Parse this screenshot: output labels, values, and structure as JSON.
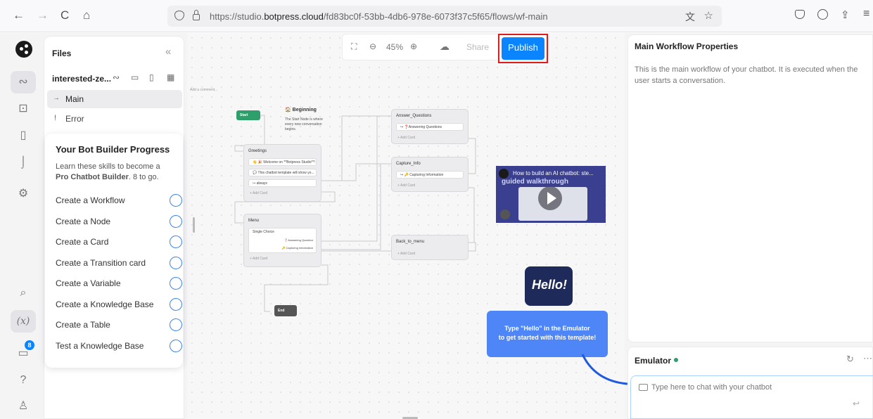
{
  "browser": {
    "back": "←",
    "forward": "→",
    "reload": "C",
    "home": "⌂",
    "url_prefix": "https://studio.",
    "url_domain": "botpress.cloud",
    "url_rest": "/fd83bc0f-53bb-4db6-978e-6073f37c5f65/flows/wf-main"
  },
  "files": {
    "title": "Files",
    "collapse": "«",
    "bot_name": "interested-ze...",
    "items": [
      {
        "label": "Main",
        "icon": "→"
      },
      {
        "label": "Error",
        "icon": "!"
      }
    ]
  },
  "progress": {
    "title": "Your Bot Builder Progress",
    "desc_1": "Learn these skills to become a",
    "desc_bold": "Pro Chatbot Builder",
    "desc_2": ". 8 to go.",
    "items": [
      "Create a Workflow",
      "Create a Node",
      "Create a Card",
      "Create a Transition card",
      "Create a Variable",
      "Create a Knowledge Base",
      "Create a Table",
      "Test a Knowledge Base"
    ]
  },
  "rail": {
    "badge": "8",
    "var": "(x)"
  },
  "toolbar": {
    "zoom": "45%",
    "share": "Share",
    "publish": "Publish"
  },
  "canvas": {
    "add_comment": "Add a comment...",
    "start": "Start",
    "beginning_title": "🏠 Beginning",
    "beginning_desc_1": "The Start Node is where",
    "beginning_desc_2": "every new conversation",
    "beginning_desc_3": "begins.",
    "greetings": {
      "title": "Greetings",
      "cards": [
        "👋 🎉 Welcome on **Botpress Studio**!",
        "💬 This chatbot template will show yo...",
        "↪ always"
      ],
      "add": "+ Add Card"
    },
    "menu": {
      "title": "Menu",
      "card": "Single Choice",
      "opt1": "❓Answering Question",
      "opt2": "🔑 Capturing Information",
      "add": "+ Add Card"
    },
    "answer": {
      "title": "Answer_Questions",
      "card": "↪ ❓Answering Questions",
      "add": "+ Add Card"
    },
    "capture": {
      "title": "Capture_Info",
      "card": "↪ 🔑 Capturing Information",
      "add": "+ Add Card"
    },
    "back": {
      "title": "Back_to_menu",
      "add": "+ Add Card"
    },
    "end": "End",
    "video_title": "How to build an AI chatbot: ste...",
    "video_sub": "guided walkthrough",
    "hello": "Hello!",
    "tip_1": "Type \"Hello\" in the Emulator",
    "tip_2": "to get started with this template!"
  },
  "right": {
    "title": "Main Workflow Properties",
    "desc": "This is the main workflow of your chatbot. It is executed when the user starts a conversation."
  },
  "emulator": {
    "title": "Emulator",
    "placeholder": "Type here to chat with your chatbot"
  },
  "colors": {
    "accent": "#0a84ff",
    "highlight": "#e01b1b",
    "start_green": "#2e9e6b",
    "tip_blue": "#4f86f7"
  }
}
